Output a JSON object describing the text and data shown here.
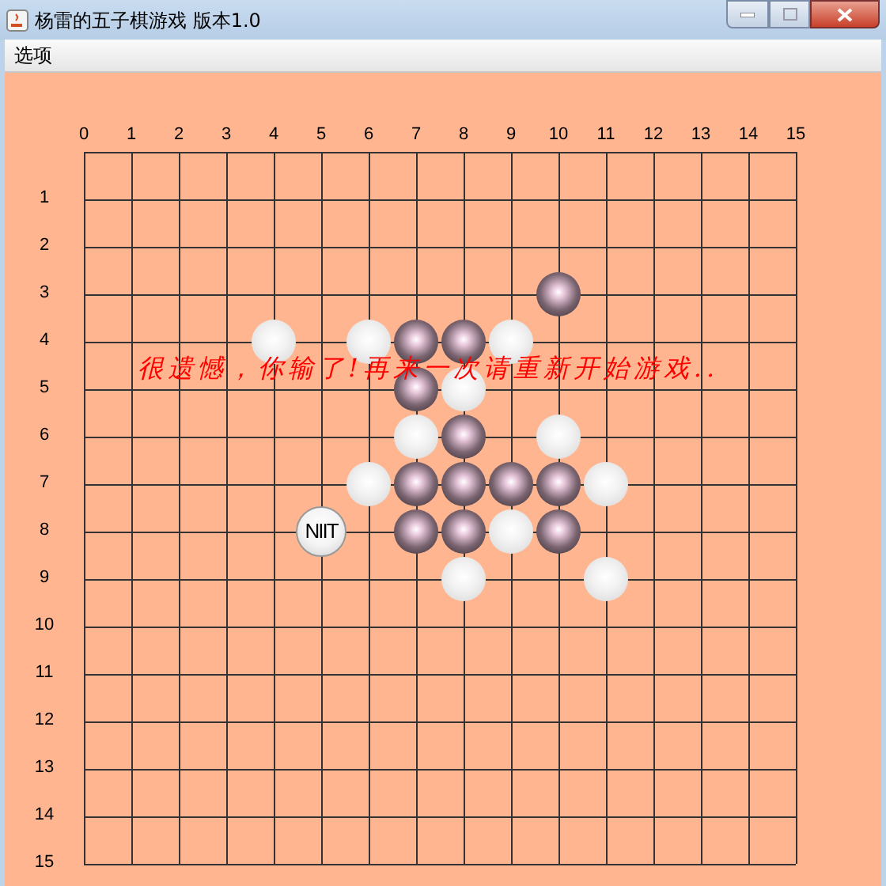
{
  "window": {
    "title": "杨雷的五子棋游戏 版本1.0"
  },
  "menu": [
    "选项"
  ],
  "board": {
    "columns": [
      "0",
      "1",
      "2",
      "3",
      "4",
      "5",
      "6",
      "7",
      "8",
      "9",
      "10",
      "11",
      "12",
      "13",
      "14",
      "15"
    ],
    "rows": [
      "1",
      "2",
      "3",
      "4",
      "5",
      "6",
      "7",
      "8",
      "9",
      "10",
      "11",
      "12",
      "13",
      "14",
      "15"
    ],
    "points": [
      [
        {
          "kind": "empty"
        },
        {
          "kind": "empty"
        },
        {
          "kind": "empty"
        },
        {
          "kind": "empty"
        },
        {
          "kind": "empty"
        },
        {
          "kind": "empty"
        },
        {
          "kind": "empty"
        },
        {
          "kind": "empty"
        },
        {
          "kind": "empty"
        },
        {
          "kind": "empty"
        },
        {
          "kind": "empty"
        },
        {
          "kind": "empty"
        },
        {
          "kind": "empty"
        },
        {
          "kind": "empty"
        },
        {
          "kind": "empty"
        },
        {
          "kind": "empty"
        }
      ],
      [
        {
          "kind": "empty"
        },
        {
          "kind": "empty"
        },
        {
          "kind": "empty"
        },
        {
          "kind": "empty"
        },
        {
          "kind": "empty"
        },
        {
          "kind": "empty"
        },
        {
          "kind": "empty"
        },
        {
          "kind": "empty"
        },
        {
          "kind": "empty"
        },
        {
          "kind": "empty"
        },
        {
          "kind": "empty"
        },
        {
          "kind": "empty"
        },
        {
          "kind": "empty"
        },
        {
          "kind": "empty"
        },
        {
          "kind": "empty"
        },
        {
          "kind": "empty"
        }
      ],
      [
        {
          "kind": "empty"
        },
        {
          "kind": "empty"
        },
        {
          "kind": "empty"
        },
        {
          "kind": "empty"
        },
        {
          "kind": "empty"
        },
        {
          "kind": "empty"
        },
        {
          "kind": "empty"
        },
        {
          "kind": "empty"
        },
        {
          "kind": "empty"
        },
        {
          "kind": "empty"
        },
        {
          "kind": "empty"
        },
        {
          "kind": "empty"
        },
        {
          "kind": "empty"
        },
        {
          "kind": "empty"
        },
        {
          "kind": "empty"
        },
        {
          "kind": "empty"
        }
      ],
      [
        {
          "kind": "empty"
        },
        {
          "kind": "empty"
        },
        {
          "kind": "empty"
        },
        {
          "kind": "empty"
        },
        {
          "kind": "empty"
        },
        {
          "kind": "empty"
        },
        {
          "kind": "empty"
        },
        {
          "kind": "empty"
        },
        {
          "kind": "empty"
        },
        {
          "kind": "empty"
        },
        {
          "kind": "black"
        },
        {
          "kind": "empty"
        },
        {
          "kind": "empty"
        },
        {
          "kind": "empty"
        },
        {
          "kind": "empty"
        },
        {
          "kind": "empty"
        }
      ],
      [
        {
          "kind": "empty"
        },
        {
          "kind": "empty"
        },
        {
          "kind": "empty"
        },
        {
          "kind": "empty"
        },
        {
          "kind": "white"
        },
        {
          "kind": "empty"
        },
        {
          "kind": "white"
        },
        {
          "kind": "black"
        },
        {
          "kind": "black"
        },
        {
          "kind": "white"
        },
        {
          "kind": "empty"
        },
        {
          "kind": "empty"
        },
        {
          "kind": "empty"
        },
        {
          "kind": "empty"
        },
        {
          "kind": "empty"
        },
        {
          "kind": "empty"
        }
      ],
      [
        {
          "kind": "empty"
        },
        {
          "kind": "empty"
        },
        {
          "kind": "empty"
        },
        {
          "kind": "empty"
        },
        {
          "kind": "empty"
        },
        {
          "kind": "empty"
        },
        {
          "kind": "empty"
        },
        {
          "kind": "black"
        },
        {
          "kind": "white"
        },
        {
          "kind": "empty"
        },
        {
          "kind": "empty"
        },
        {
          "kind": "empty"
        },
        {
          "kind": "empty"
        },
        {
          "kind": "empty"
        },
        {
          "kind": "empty"
        },
        {
          "kind": "empty"
        }
      ],
      [
        {
          "kind": "empty"
        },
        {
          "kind": "empty"
        },
        {
          "kind": "empty"
        },
        {
          "kind": "empty"
        },
        {
          "kind": "empty"
        },
        {
          "kind": "empty"
        },
        {
          "kind": "empty"
        },
        {
          "kind": "white"
        },
        {
          "kind": "black"
        },
        {
          "kind": "empty"
        },
        {
          "kind": "white"
        },
        {
          "kind": "empty"
        },
        {
          "kind": "empty"
        },
        {
          "kind": "empty"
        },
        {
          "kind": "empty"
        },
        {
          "kind": "empty"
        }
      ],
      [
        {
          "kind": "empty"
        },
        {
          "kind": "empty"
        },
        {
          "kind": "empty"
        },
        {
          "kind": "empty"
        },
        {
          "kind": "empty"
        },
        {
          "kind": "empty"
        },
        {
          "kind": "white"
        },
        {
          "kind": "black"
        },
        {
          "kind": "black"
        },
        {
          "kind": "black"
        },
        {
          "kind": "black"
        },
        {
          "kind": "white"
        },
        {
          "kind": "empty"
        },
        {
          "kind": "empty"
        },
        {
          "kind": "empty"
        },
        {
          "kind": "empty"
        }
      ],
      [
        {
          "kind": "empty"
        },
        {
          "kind": "empty"
        },
        {
          "kind": "empty"
        },
        {
          "kind": "empty"
        },
        {
          "kind": "empty"
        },
        {
          "kind": "cursor",
          "label": "NIIT"
        },
        {
          "kind": "empty"
        },
        {
          "kind": "black"
        },
        {
          "kind": "black"
        },
        {
          "kind": "white"
        },
        {
          "kind": "black"
        },
        {
          "kind": "empty"
        },
        {
          "kind": "empty"
        },
        {
          "kind": "empty"
        },
        {
          "kind": "empty"
        },
        {
          "kind": "empty"
        }
      ],
      [
        {
          "kind": "empty"
        },
        {
          "kind": "empty"
        },
        {
          "kind": "empty"
        },
        {
          "kind": "empty"
        },
        {
          "kind": "empty"
        },
        {
          "kind": "empty"
        },
        {
          "kind": "empty"
        },
        {
          "kind": "empty"
        },
        {
          "kind": "white"
        },
        {
          "kind": "empty"
        },
        {
          "kind": "empty"
        },
        {
          "kind": "white"
        },
        {
          "kind": "empty"
        },
        {
          "kind": "empty"
        },
        {
          "kind": "empty"
        },
        {
          "kind": "empty"
        }
      ],
      [
        {
          "kind": "empty"
        },
        {
          "kind": "empty"
        },
        {
          "kind": "empty"
        },
        {
          "kind": "empty"
        },
        {
          "kind": "empty"
        },
        {
          "kind": "empty"
        },
        {
          "kind": "empty"
        },
        {
          "kind": "empty"
        },
        {
          "kind": "empty"
        },
        {
          "kind": "empty"
        },
        {
          "kind": "empty"
        },
        {
          "kind": "empty"
        },
        {
          "kind": "empty"
        },
        {
          "kind": "empty"
        },
        {
          "kind": "empty"
        },
        {
          "kind": "empty"
        }
      ],
      [
        {
          "kind": "empty"
        },
        {
          "kind": "empty"
        },
        {
          "kind": "empty"
        },
        {
          "kind": "empty"
        },
        {
          "kind": "empty"
        },
        {
          "kind": "empty"
        },
        {
          "kind": "empty"
        },
        {
          "kind": "empty"
        },
        {
          "kind": "empty"
        },
        {
          "kind": "empty"
        },
        {
          "kind": "empty"
        },
        {
          "kind": "empty"
        },
        {
          "kind": "empty"
        },
        {
          "kind": "empty"
        },
        {
          "kind": "empty"
        },
        {
          "kind": "empty"
        }
      ],
      [
        {
          "kind": "empty"
        },
        {
          "kind": "empty"
        },
        {
          "kind": "empty"
        },
        {
          "kind": "empty"
        },
        {
          "kind": "empty"
        },
        {
          "kind": "empty"
        },
        {
          "kind": "empty"
        },
        {
          "kind": "empty"
        },
        {
          "kind": "empty"
        },
        {
          "kind": "empty"
        },
        {
          "kind": "empty"
        },
        {
          "kind": "empty"
        },
        {
          "kind": "empty"
        },
        {
          "kind": "empty"
        },
        {
          "kind": "empty"
        },
        {
          "kind": "empty"
        }
      ],
      [
        {
          "kind": "empty"
        },
        {
          "kind": "empty"
        },
        {
          "kind": "empty"
        },
        {
          "kind": "empty"
        },
        {
          "kind": "empty"
        },
        {
          "kind": "empty"
        },
        {
          "kind": "empty"
        },
        {
          "kind": "empty"
        },
        {
          "kind": "empty"
        },
        {
          "kind": "empty"
        },
        {
          "kind": "empty"
        },
        {
          "kind": "empty"
        },
        {
          "kind": "empty"
        },
        {
          "kind": "empty"
        },
        {
          "kind": "empty"
        },
        {
          "kind": "empty"
        }
      ],
      [
        {
          "kind": "empty"
        },
        {
          "kind": "empty"
        },
        {
          "kind": "empty"
        },
        {
          "kind": "empty"
        },
        {
          "kind": "empty"
        },
        {
          "kind": "empty"
        },
        {
          "kind": "empty"
        },
        {
          "kind": "empty"
        },
        {
          "kind": "empty"
        },
        {
          "kind": "empty"
        },
        {
          "kind": "empty"
        },
        {
          "kind": "empty"
        },
        {
          "kind": "empty"
        },
        {
          "kind": "empty"
        },
        {
          "kind": "empty"
        },
        {
          "kind": "empty"
        }
      ],
      [
        {
          "kind": "empty"
        },
        {
          "kind": "empty"
        },
        {
          "kind": "empty"
        },
        {
          "kind": "empty"
        },
        {
          "kind": "empty"
        },
        {
          "kind": "empty"
        },
        {
          "kind": "empty"
        },
        {
          "kind": "empty"
        },
        {
          "kind": "empty"
        },
        {
          "kind": "empty"
        },
        {
          "kind": "empty"
        },
        {
          "kind": "empty"
        },
        {
          "kind": "empty"
        },
        {
          "kind": "empty"
        },
        {
          "kind": "empty"
        },
        {
          "kind": "empty"
        }
      ]
    ],
    "message": "很遗憾，你输了!再来一次请重新开始游戏.."
  }
}
